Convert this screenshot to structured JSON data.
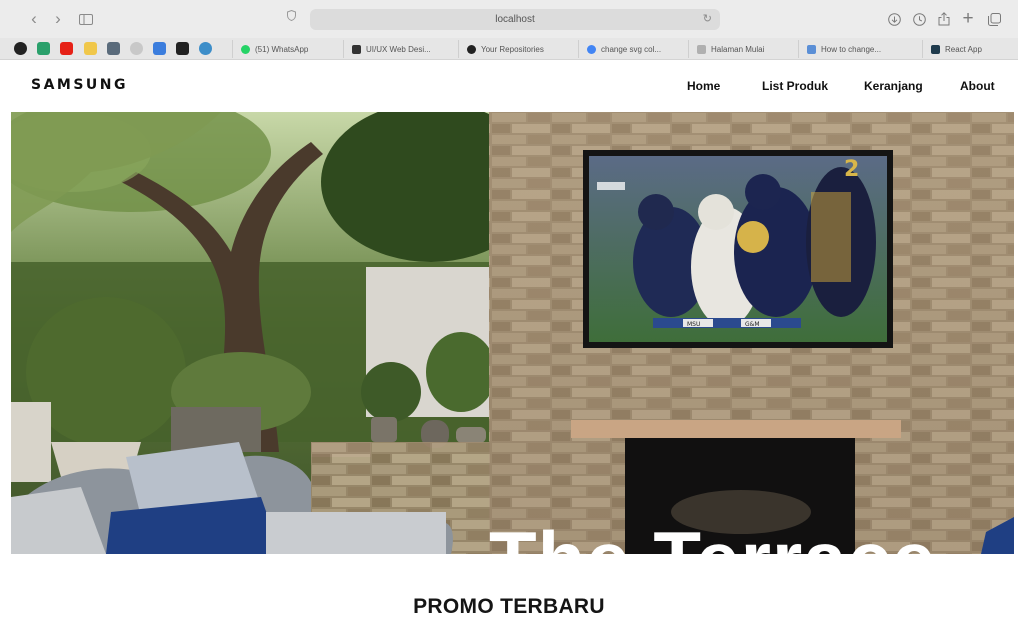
{
  "browser": {
    "url": "localhost",
    "bookmarks": [
      {
        "label": "(51) WhatsApp",
        "color": "#25d366"
      },
      {
        "label": "UI/UX Web Desi...",
        "color": "#333333"
      },
      {
        "label": "Your Repositories",
        "color": "#222222"
      },
      {
        "label": "change svg col...",
        "color": "#4285f4"
      },
      {
        "label": "Halaman Mulai",
        "color": "#9a9a9a"
      },
      {
        "label": "How to change...",
        "color": "#5b8fd6"
      },
      {
        "label": "React App",
        "color": "#1f3b4d"
      }
    ]
  },
  "site": {
    "logo": "SAMSUNG",
    "nav": {
      "home": "Home",
      "products": "List Produk",
      "cart": "Keranjang",
      "about": "About"
    }
  },
  "hero": {
    "headline": "The Terrace",
    "tv_left_team": "MSU",
    "tv_right_team": "G&M",
    "player_number": "2"
  },
  "promo": {
    "title": "PROMO TERBARU"
  }
}
